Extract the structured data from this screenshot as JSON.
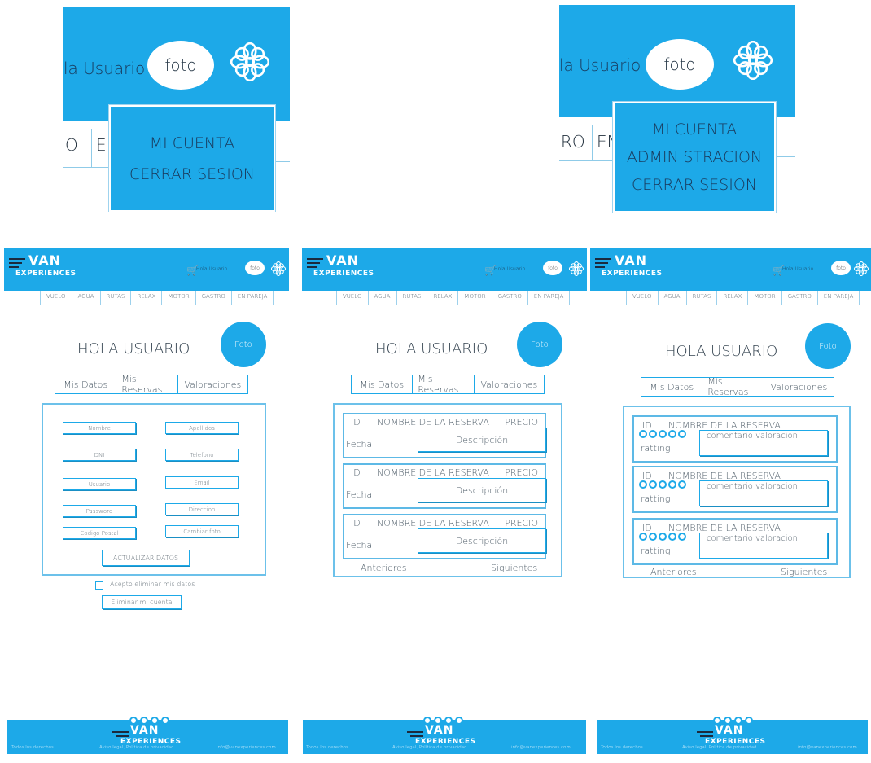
{
  "zoom_user": {
    "greeting": "la Usuario",
    "photo": "foto",
    "nav_fragment_1": "O",
    "nav_fragment_2": "EN",
    "menu": [
      "MI CUENTA",
      "CERRAR SESION"
    ]
  },
  "zoom_admin": {
    "greeting": "la Usuario",
    "photo": "foto",
    "nav_fragment_1": "RO",
    "nav_fragment_2": "EN",
    "menu": [
      "MI CUENTA",
      "ADMINISTRACION",
      "CERRAR SESION"
    ]
  },
  "header": {
    "logo_van": "VAN",
    "logo_sub": "EXPERIENCES",
    "greeting": "Hola Usuario",
    "photo": "foto",
    "cart_icon": "shopping-cart-icon",
    "flower_icon": "flower-icon"
  },
  "nav": [
    "VUELO",
    "AGUA",
    "RUTAS",
    "RELAX",
    "MOTOR",
    "GASTRO",
    "EN PAREJA"
  ],
  "page": {
    "title": "HOLA USUARIO",
    "photo": "Foto",
    "tabs": [
      "Mis Datos",
      "Mis Reservas",
      "Valoraciones"
    ]
  },
  "datos": {
    "fields": [
      "Nombre",
      "Apellidos",
      "DNI",
      "Telefono",
      "Usuario",
      "Email",
      "Password",
      "Direccion",
      "Codigo Postal",
      "Cambiar foto"
    ],
    "update_button": "ACTUALIZAR DATOS",
    "checkbox_label": "Acepto eliminar mis datos",
    "delete_button": "Eliminar mi cuenta"
  },
  "reservas": {
    "items": [
      {
        "id": "ID",
        "name": "NOMBRE DE LA RESERVA",
        "price": "PRECIO",
        "date": "Fecha",
        "desc": "Descripción"
      },
      {
        "id": "ID",
        "name": "NOMBRE DE LA RESERVA",
        "price": "PRECIO",
        "date": "Fecha",
        "desc": "Descripción"
      },
      {
        "id": "ID",
        "name": "NOMBRE DE LA RESERVA",
        "price": "PRECIO",
        "date": "Fecha",
        "desc": "Descripción"
      }
    ],
    "prev": "Anteriores",
    "next": "Siguientes"
  },
  "valoraciones": {
    "items": [
      {
        "id": "ID",
        "name": "NOMBRE DE LA RESERVA",
        "rating": "ratting",
        "comment": "comentario valoracion"
      },
      {
        "id": "ID",
        "name": "NOMBRE DE LA RESERVA",
        "rating": "ratting",
        "comment": "comentario valoracion"
      },
      {
        "id": "ID",
        "name": "NOMBRE DE LA RESERVA",
        "rating": "ratting",
        "comment": "comentario valoracion"
      }
    ],
    "prev": "Anteriores",
    "next": "Siguientes"
  },
  "footer": {
    "rights": "Todos los derechos...",
    "legal": "Aviso legal, Política de privacidad",
    "email": "info@vanexperiences.com",
    "logo_van": "VAN",
    "logo_sub": "EXPERIENCES"
  },
  "colors": {
    "brand_blue": "#1da9e8",
    "dark_navy": "#1b2a3d"
  }
}
